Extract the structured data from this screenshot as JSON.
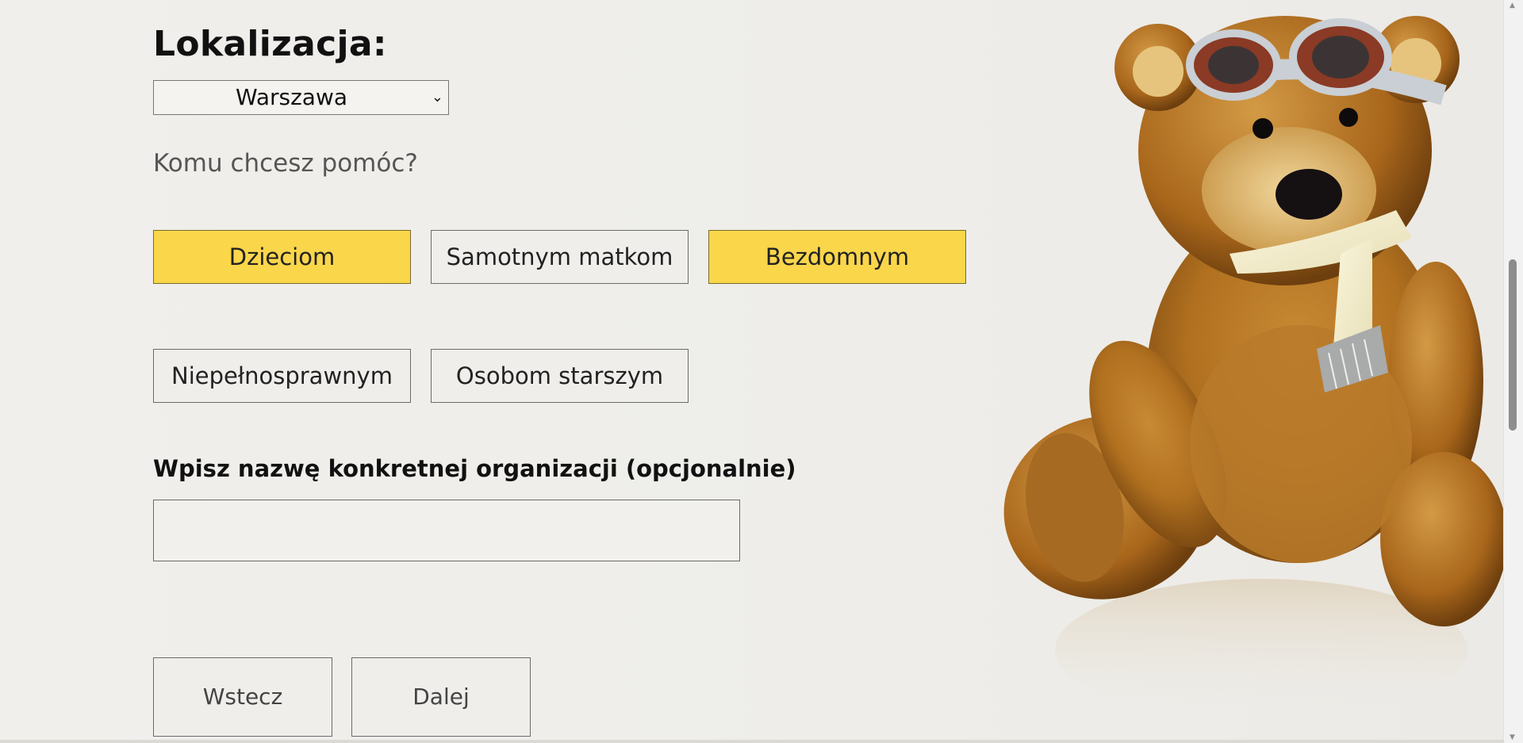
{
  "location": {
    "title": "Lokalizacja:",
    "selected": "Warszawa"
  },
  "question": "Komu chcesz pomóc?",
  "categories": [
    {
      "label": "Dzieciom",
      "selected": true
    },
    {
      "label": "Samotnym matkom",
      "selected": false
    },
    {
      "label": "Bezdomnym",
      "selected": true
    },
    {
      "label": "Niepełnosprawnym",
      "selected": false
    },
    {
      "label": "Osobom starszym",
      "selected": false
    }
  ],
  "organization": {
    "label": "Wpisz nazwę konkretnej organizacji (opcjonalnie)",
    "value": ""
  },
  "navigation": {
    "back_label": "Wstecz",
    "next_label": "Dalej"
  },
  "colors": {
    "selected_tile": "#fad64a",
    "background": "#efeeeb"
  },
  "icons": {
    "select_arrow": "chevron-down-icon"
  }
}
